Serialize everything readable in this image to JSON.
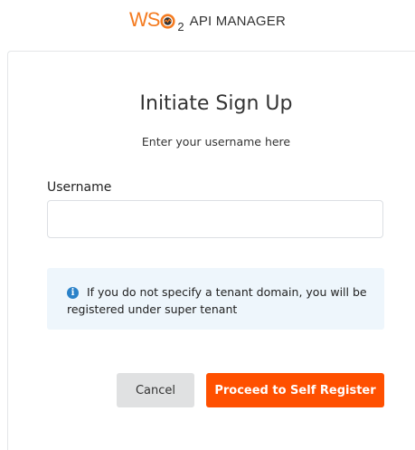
{
  "header": {
    "logo_text": "WSO2",
    "product_name": "API MANAGER",
    "brand_color": "#f47b20"
  },
  "form": {
    "title": "Initiate Sign Up",
    "subtitle": "Enter your username here",
    "username_label": "Username",
    "username_value": "",
    "username_placeholder": ""
  },
  "info": {
    "icon": "info-circle-icon",
    "message": "If you do not specify a tenant domain, you will be registered under super tenant",
    "background_color": "#eef6fc"
  },
  "actions": {
    "cancel_label": "Cancel",
    "proceed_label": "Proceed to Self Register",
    "proceed_color": "#ff5000"
  }
}
